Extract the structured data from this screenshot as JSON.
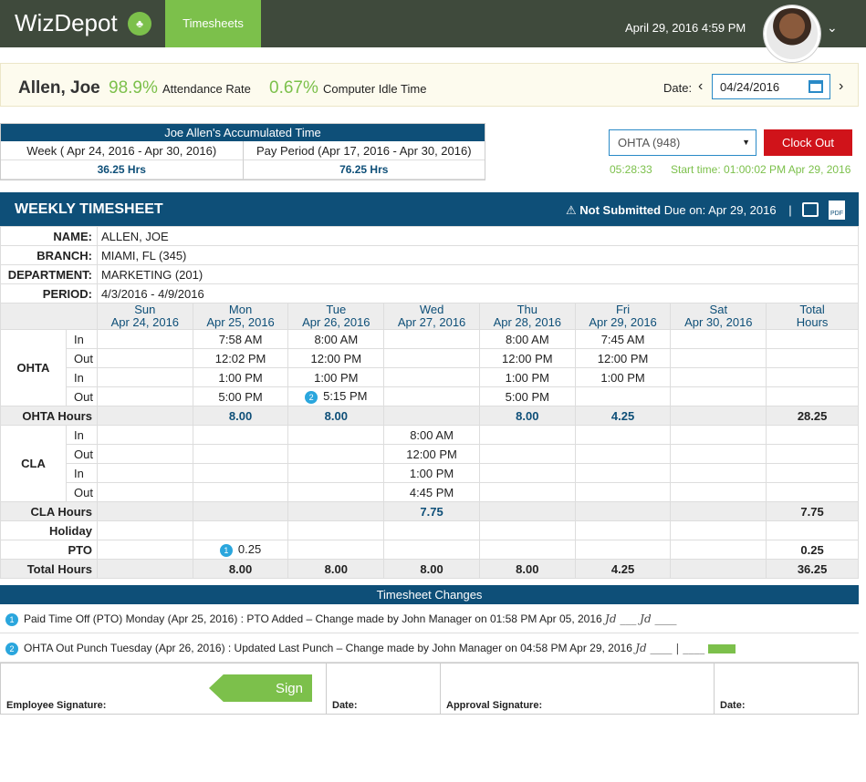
{
  "app": {
    "name": "WizDepot",
    "tab": "Timesheets",
    "datetime": "April 29, 2016 4:59 PM"
  },
  "employee": {
    "name": "Allen, Joe",
    "attendance_rate": "98.9%",
    "attendance_label": "Attendance Rate",
    "idle_time": "0.67%",
    "idle_label": "Computer Idle Time"
  },
  "date_picker": {
    "label": "Date:",
    "value": "04/24/2016"
  },
  "accumulated": {
    "title": "Joe Allen's Accumulated Time",
    "week_label": "Week ( Apr 24, 2016 - Apr 30, 2016)",
    "week_value": "36.25 Hrs",
    "period_label": "Pay Period (Apr 17, 2016 - Apr 30, 2016)",
    "period_value": "76.25 Hrs"
  },
  "clock": {
    "select_value": "OHTA (948)",
    "button": "Clock Out",
    "timer": "05:28:33",
    "start": "Start time: 01:00:02 PM Apr 29, 2016"
  },
  "weekly": {
    "title": "WEEKLY TIMESHEET",
    "status": "Not Submitted",
    "due": "Due on: Apr 29, 2016",
    "sep": "|",
    "name_label": "NAME:",
    "name": "ALLEN, JOE",
    "branch_label": "BRANCH:",
    "branch": "MIAMI, FL (345)",
    "dept_label": "DEPARTMENT:",
    "dept": "MARKETING (201)",
    "period_label": "PERIOD:",
    "period": "4/3/2016 - 4/9/2016",
    "days": [
      {
        "d": "Sun",
        "date": "Apr 24, 2016"
      },
      {
        "d": "Mon",
        "date": "Apr 25, 2016"
      },
      {
        "d": "Tue",
        "date": "Apr 26, 2016"
      },
      {
        "d": "Wed",
        "date": "Apr 27, 2016"
      },
      {
        "d": "Thu",
        "date": "Apr 28, 2016"
      },
      {
        "d": "Fri",
        "date": "Apr 29, 2016"
      },
      {
        "d": "Sat",
        "date": "Apr 30, 2016"
      }
    ],
    "total_head": "Total",
    "total_head2": "Hours",
    "ohta": "OHTA",
    "ohta_rows": [
      {
        "t": "In",
        "v": [
          "",
          "7:58 AM",
          "8:00 AM",
          "",
          "8:00 AM",
          "7:45 AM",
          ""
        ]
      },
      {
        "t": "Out",
        "v": [
          "",
          "12:02 PM",
          "12:00 PM",
          "",
          "12:00 PM",
          "12:00 PM",
          ""
        ]
      },
      {
        "t": "In",
        "v": [
          "",
          "1:00 PM",
          "1:00 PM",
          "",
          "1:00 PM",
          "1:00 PM",
          ""
        ]
      },
      {
        "t": "Out",
        "v": [
          "",
          "5:00 PM",
          "5:15 PM",
          "",
          "5:00 PM",
          "",
          ""
        ]
      }
    ],
    "ohta_hours_label": "OHTA Hours",
    "ohta_hours": [
      "",
      "8.00",
      "8.00",
      "",
      "8.00",
      "4.25",
      "",
      "28.25"
    ],
    "cla": "CLA",
    "cla_rows": [
      {
        "t": "In",
        "v": [
          "",
          "",
          "",
          "8:00 AM",
          "",
          "",
          ""
        ]
      },
      {
        "t": "Out",
        "v": [
          "",
          "",
          "",
          "12:00 PM",
          "",
          "",
          ""
        ]
      },
      {
        "t": "In",
        "v": [
          "",
          "",
          "",
          "1:00 PM",
          "",
          "",
          ""
        ]
      },
      {
        "t": "Out",
        "v": [
          "",
          "",
          "",
          "4:45 PM",
          "",
          "",
          ""
        ]
      }
    ],
    "cla_hours_label": "CLA Hours",
    "cla_hours": [
      "",
      "",
      "",
      "7.75",
      "",
      "",
      "",
      "7.75"
    ],
    "holiday_label": "Holiday",
    "pto_label": "PTO",
    "pto": [
      "",
      "0.25",
      "",
      "",
      "",
      "",
      "",
      "0.25"
    ],
    "total_label": "Total Hours",
    "totals": [
      "",
      "8.00",
      "8.00",
      "8.00",
      "8.00",
      "4.25",
      "",
      "36.25"
    ]
  },
  "changes": {
    "title": "Timesheet Changes",
    "items": [
      {
        "n": "1",
        "text": "Paid Time Off (PTO) Monday (Apr 25, 2016) : PTO Added – Change made by John Manager on 01:58 PM Apr 05, 2016"
      },
      {
        "n": "2",
        "text": "OHTA Out Punch Tuesday (Apr 26, 2016) : Updated Last Punch – Change made by John Manager on 04:58 PM Apr 29, 2016"
      }
    ]
  },
  "signatures": {
    "employee": "Employee Signature:",
    "date": "Date:",
    "approval": "Approval Signature:",
    "date2": "Date:",
    "sign": "Sign"
  }
}
